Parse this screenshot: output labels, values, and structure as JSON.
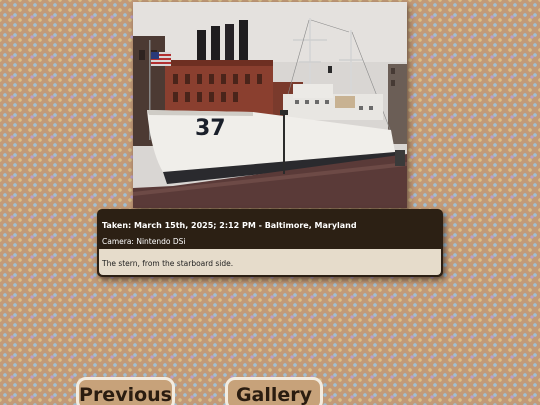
{
  "photo": {
    "subject": "ship-photo",
    "hull_number": "37"
  },
  "info": {
    "taken": "Taken: March 15th, 2025; 2:12 PM - Baltimore, Maryland",
    "camera": "Camera: Nintendo DSi",
    "caption": "The stern, from the starboard side."
  },
  "nav": {
    "previous_label": "Previous",
    "gallery_label": "Gallery"
  }
}
